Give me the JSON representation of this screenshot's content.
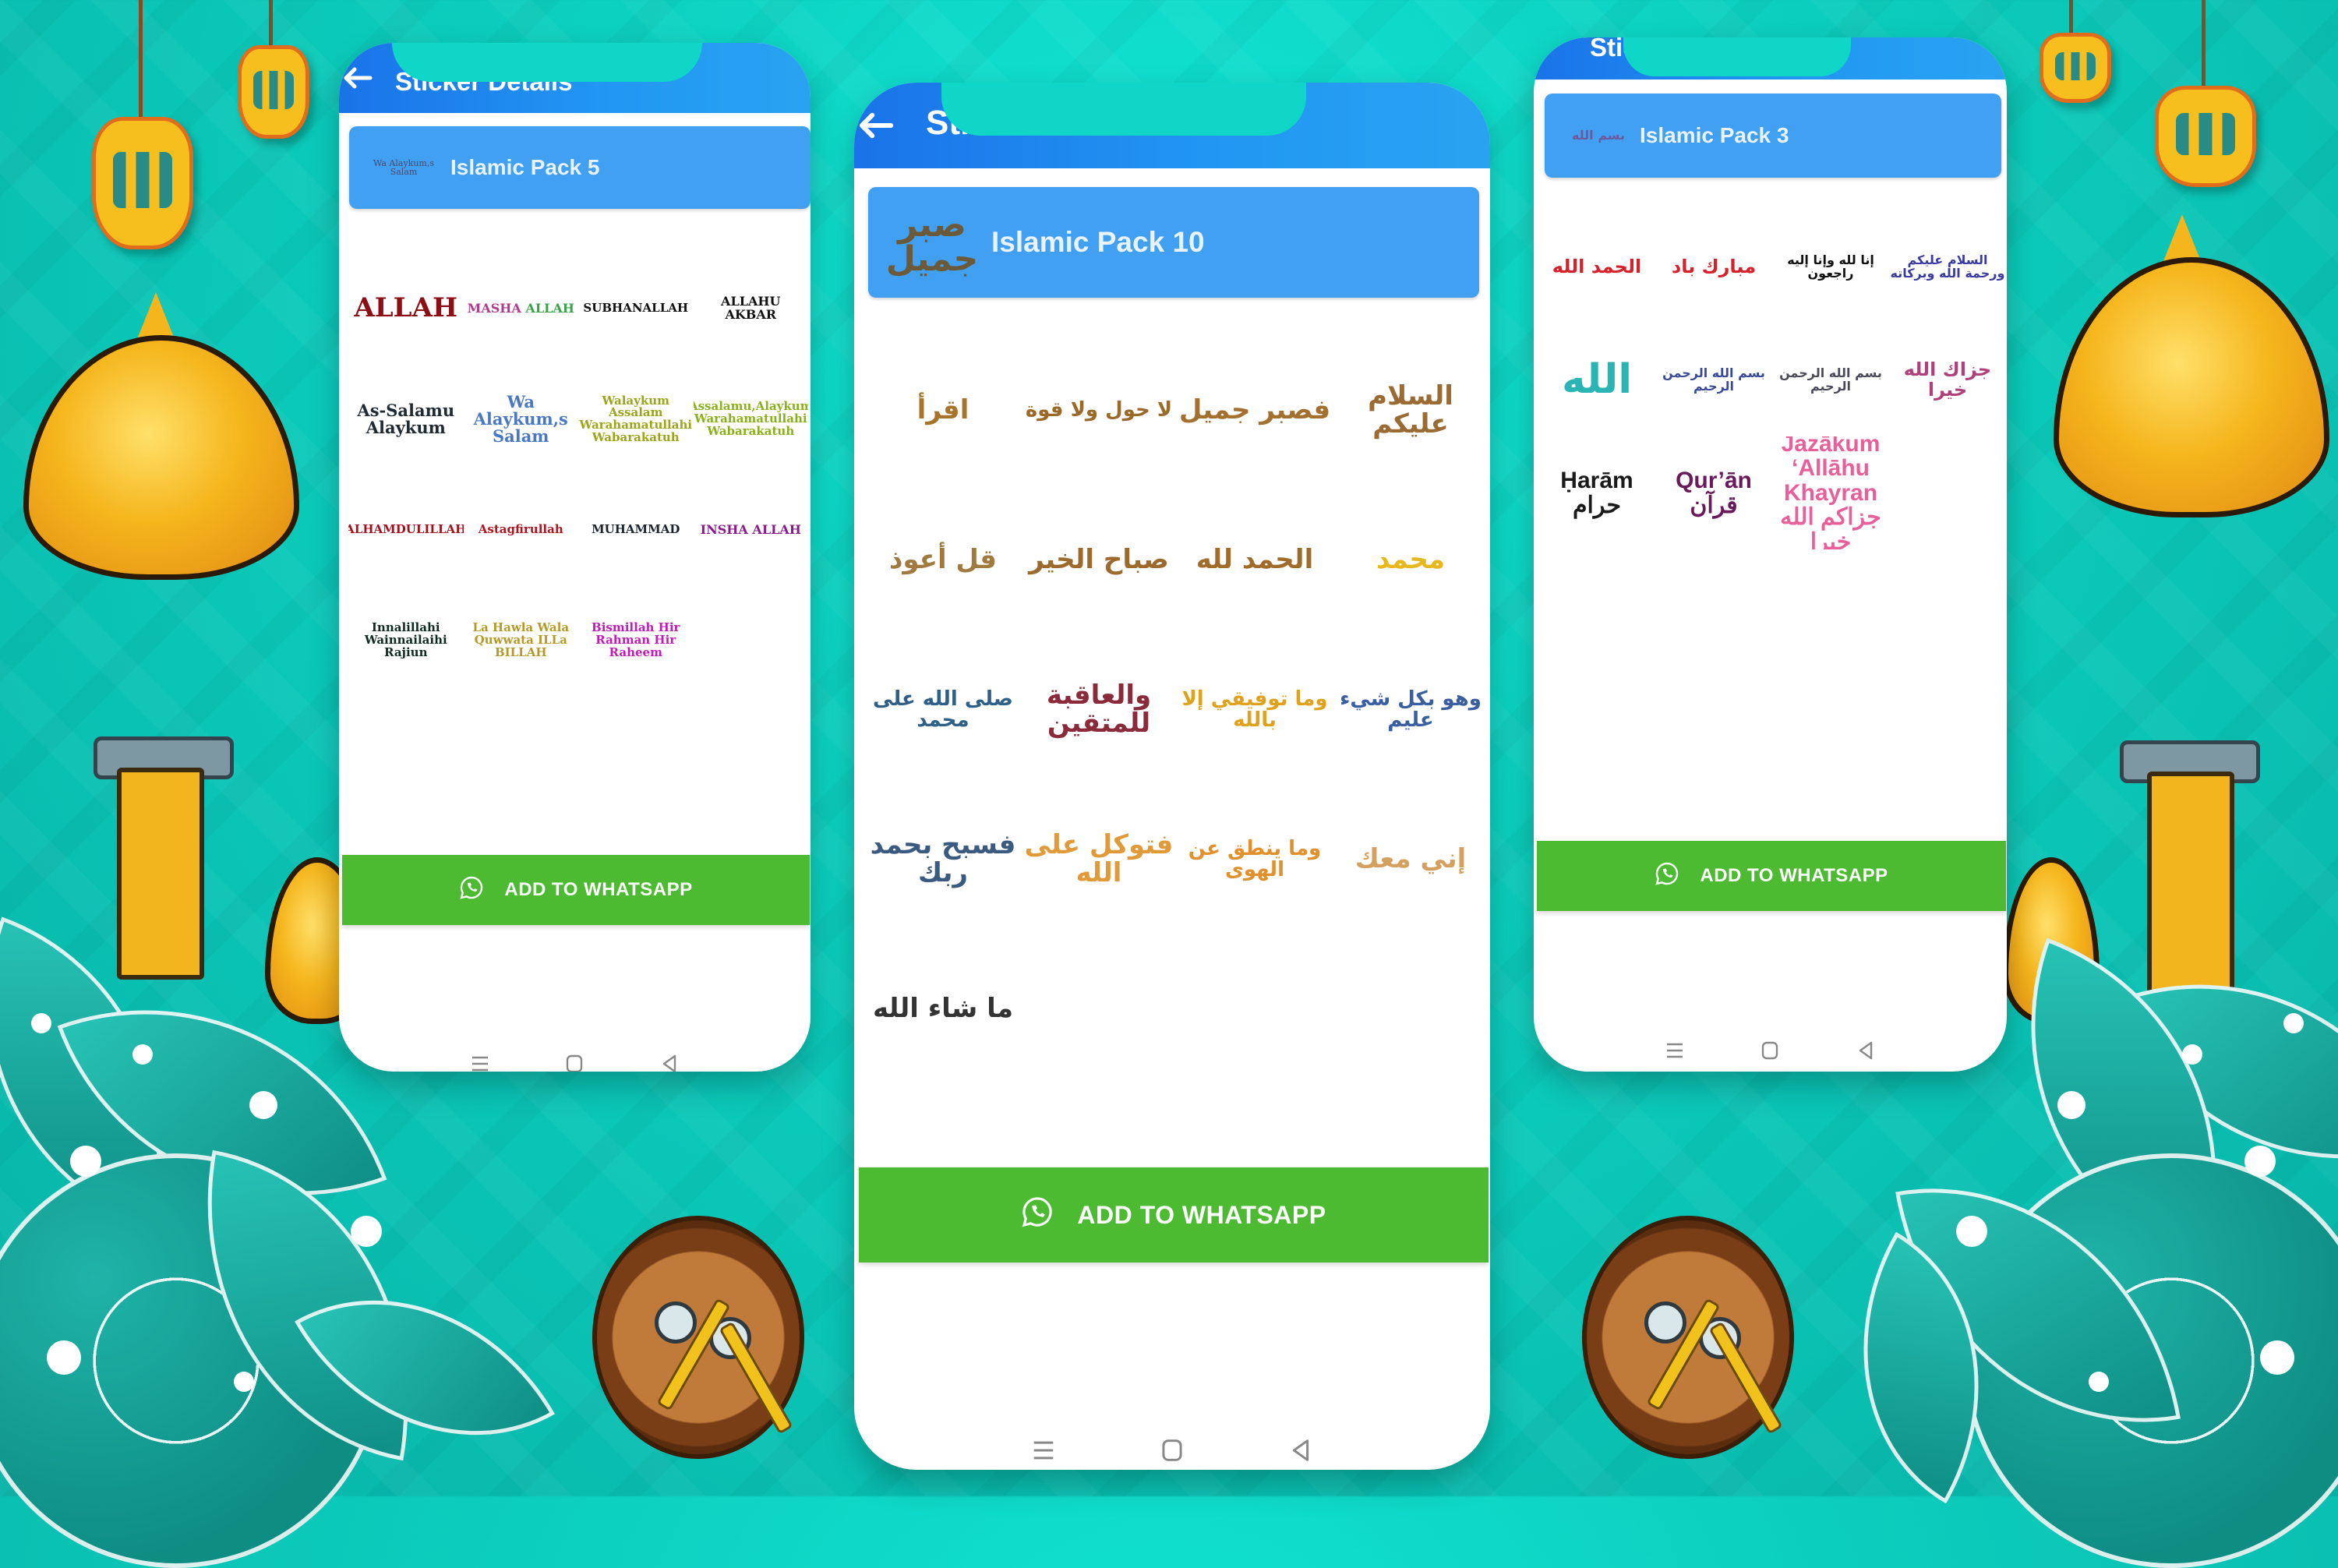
{
  "colors": {
    "background": "#0ccfbf",
    "appbar": "#1a73e8",
    "pack_card": "#42a0f2",
    "whatsapp_button": "#4cbb32",
    "text_on_blue": "#ffffff"
  },
  "phones": [
    {
      "id": "left",
      "appbar": {
        "back_icon": "arrow-left-icon",
        "title": "Sticker Details"
      },
      "pack": {
        "name": "Islamic Pack 5",
        "thumbnail_text": "Wa Alaykum,s Salam"
      },
      "stickers": [
        {
          "text": "ALLAH",
          "color": "#8b0f14",
          "script": "latin"
        },
        {
          "text": "MASHA ALLAH",
          "color": "#b03a8e",
          "color2": "#3aa34a",
          "script": "latin"
        },
        {
          "text": "SUBHANALLAH",
          "color": "#111111",
          "script": "latin"
        },
        {
          "text": "ALLAHU AKBAR",
          "color": "#111111",
          "script": "latin"
        },
        {
          "text": "As-Salamu Alaykum",
          "color": "#1f2a33",
          "script": "latin"
        },
        {
          "text": "Wa Alaykum,s Salam",
          "color": "#4a78c2",
          "script": "latin"
        },
        {
          "text": "Walaykum Assalam Warahamatullahi Wabarakatuh",
          "color": "#9aa51a",
          "script": "latin"
        },
        {
          "text": "Assalamu,Alaykum Warahamatullahi Wabarakatuh",
          "color": "#8ab01c",
          "script": "latin"
        },
        {
          "text": "ALHAMDULILLAH",
          "color": "#a3121c",
          "script": "latin"
        },
        {
          "text": "Astagfirullah",
          "color": "#b0141e",
          "script": "latin"
        },
        {
          "text": "MUHAMMAD",
          "color": "#1b2430",
          "script": "latin"
        },
        {
          "text": "INSHA ALLAH",
          "color": "#8a1a8c",
          "script": "latin"
        },
        {
          "text": "Innalillahi Wainnailaihi Rajiun",
          "color": "#0f2a22",
          "script": "latin"
        },
        {
          "text": "La Hawla Wala Quwwata ILLa BILLAH",
          "color": "#b59a28",
          "script": "latin"
        },
        {
          "text": "Bismillah Hir Rahman Hir Raheem",
          "color": "#c21cb8",
          "script": "latin"
        }
      ],
      "button": {
        "icon": "whatsapp-icon",
        "label": "ADD TO WHATSAPP"
      },
      "nav": [
        "menu-icon",
        "home-icon",
        "back-icon"
      ]
    },
    {
      "id": "middle",
      "appbar": {
        "back_icon": "arrow-left-icon",
        "title": "Sticker Details"
      },
      "pack": {
        "name": "Islamic Pack 10",
        "thumbnail_text": "صبر جميل"
      },
      "stickers": [
        {
          "text": "اقرأ",
          "color": "#a8742a",
          "script": "arabic"
        },
        {
          "text": "لا حول ولا قوة",
          "color": "#9c6a28",
          "script": "arabic"
        },
        {
          "text": "فصبر جميل",
          "color": "#a37030",
          "script": "arabic"
        },
        {
          "text": "السلام عليكم",
          "color": "#9a6c34",
          "script": "arabic"
        },
        {
          "text": "قل أعوذ",
          "color": "#a07a3e",
          "script": "arabic"
        },
        {
          "text": "صباح الخير",
          "color": "#9c6a2c",
          "script": "arabic"
        },
        {
          "text": "الحمد لله",
          "color": "#a06c2c",
          "script": "arabic"
        },
        {
          "text": "محمد",
          "color": "#e6b81e",
          "script": "arabic"
        },
        {
          "text": "صلى الله على محمد",
          "color": "#2f5f86",
          "script": "arabic"
        },
        {
          "text": "والعاقبة للمتقين",
          "color": "#8a2a3a",
          "script": "arabic"
        },
        {
          "text": "وما توفيقي إلا بالله",
          "color": "#e0a21c",
          "script": "arabic"
        },
        {
          "text": "وهو بكل شيء عليم",
          "color": "#3a5fa0",
          "script": "arabic"
        },
        {
          "text": "فسبح بحمد ربك",
          "color": "#3a5a80",
          "script": "arabic"
        },
        {
          "text": "فتوكل على الله",
          "color": "#e09a3a",
          "script": "arabic"
        },
        {
          "text": "وما ينطق عن الهوى",
          "color": "#e0902c",
          "script": "arabic"
        },
        {
          "text": "إني معك",
          "color": "#d4a060",
          "script": "arabic"
        },
        {
          "text": "ما شاء الله",
          "color": "#333333",
          "script": "arabic"
        }
      ],
      "button": {
        "icon": "whatsapp-icon",
        "label": "ADD TO WHATSAPP"
      },
      "nav": [
        "menu-icon",
        "home-icon",
        "back-icon"
      ]
    },
    {
      "id": "right",
      "appbar": {
        "back_icon": "arrow-left-icon",
        "title": "Sticker Details"
      },
      "pack": {
        "name": "Islamic Pack 3",
        "thumbnail_text": "بسم الله"
      },
      "stickers": [
        {
          "text": "الحمد الله",
          "color": "#d6202a",
          "script": "arabic"
        },
        {
          "text": "مبارك باد",
          "color": "#d6202a",
          "script": "arabic"
        },
        {
          "text": "إنا لله وإنا إليه راجعون",
          "color": "#111111",
          "script": "arabic"
        },
        {
          "text": "السلام عليكم ورحمة الله وبركاته",
          "color": "#3a3aa0",
          "script": "arabic"
        },
        {
          "text": "الله",
          "color": "#2ab4b4",
          "script": "arabic"
        },
        {
          "text": "بسم الله الرحمن الرحيم",
          "color": "#3a4a9a",
          "script": "arabic"
        },
        {
          "text": "بسم الله الرحمن الرحيم",
          "color": "#4a4a5a",
          "script": "arabic"
        },
        {
          "text": "جزاك الله خيرا",
          "color": "#b0407a",
          "script": "arabic"
        },
        {
          "text": "Ḥarām حرام",
          "color": "#1a1a1a",
          "script": "latin-sans"
        },
        {
          "text": "Qur’ān قرآن",
          "color": "#6a1a5a",
          "script": "latin-sans"
        },
        {
          "text": "Jazākum ‘Allāhu Khayran جزاكم الله خيرا",
          "color": "#e8609a",
          "script": "latin-sans"
        }
      ],
      "button": {
        "icon": "whatsapp-icon",
        "label": "ADD TO WHATSAPP"
      },
      "nav": [
        "menu-icon",
        "home-icon",
        "back-icon"
      ]
    }
  ]
}
